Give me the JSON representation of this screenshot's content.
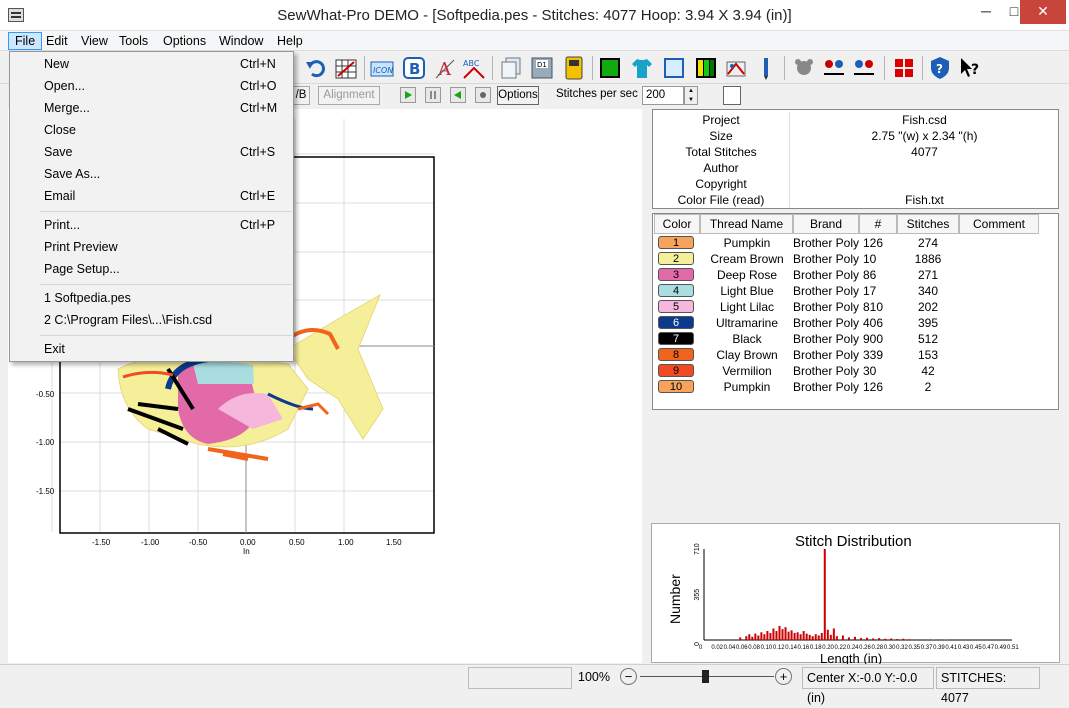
{
  "window": {
    "title": "SewWhat-Pro DEMO - [Softpedia.pes - Stitches: 4077  Hoop: 3.94 X 3.94 (in)]",
    "minimize": "─",
    "maximize": "□",
    "close": "✕"
  },
  "menubar": [
    "File",
    "Edit",
    "View",
    "Tools",
    "Options",
    "Window",
    "Help"
  ],
  "file_menu": {
    "groups": [
      [
        {
          "label": "New",
          "shortcut": "Ctrl+N"
        },
        {
          "label": "Open...",
          "shortcut": "Ctrl+O"
        },
        {
          "label": "Merge...",
          "shortcut": "Ctrl+M"
        },
        {
          "label": "Close",
          "shortcut": ""
        },
        {
          "label": "Save",
          "shortcut": "Ctrl+S"
        },
        {
          "label": "Save As...",
          "shortcut": ""
        },
        {
          "label": "Email",
          "shortcut": "Ctrl+E"
        }
      ],
      [
        {
          "label": "Print...",
          "shortcut": "Ctrl+P"
        },
        {
          "label": "Print Preview",
          "shortcut": ""
        },
        {
          "label": "Page Setup...",
          "shortcut": ""
        }
      ],
      [
        {
          "label": "1 Softpedia.pes",
          "shortcut": ""
        },
        {
          "label": "2 C:\\Program Files\\...\\Fish.csd",
          "shortcut": ""
        }
      ],
      [
        {
          "label": "Exit",
          "shortcut": ""
        }
      ]
    ]
  },
  "toolbar2": {
    "wb_label": "/B",
    "alignment_label": "Alignment",
    "options_label": "Options",
    "spins_label": "Stitches per sec",
    "spins_value": "200"
  },
  "plot": {
    "x_ticks": [
      "-1.50",
      "-1.00",
      "-0.50",
      "0.00",
      "0.50",
      "1.00",
      "1.50"
    ],
    "y_ticks": [
      "-0.50",
      "-1.00",
      "-1.50"
    ],
    "x_unit": "In"
  },
  "info": [
    {
      "key": "Project",
      "value": "Fish.csd"
    },
    {
      "key": "Size",
      "value": "2.75 \"(w) x 2.34 \"(h)"
    },
    {
      "key": "Total Stitches",
      "value": "4077"
    },
    {
      "key": "Author",
      "value": ""
    },
    {
      "key": "Copyright",
      "value": ""
    },
    {
      "key": "Color File (read)",
      "value": "Fish.txt"
    }
  ],
  "thread_headers": [
    "Color",
    "Thread Name",
    "Brand",
    "#",
    "Stitches",
    "Comment"
  ],
  "threads": [
    {
      "n": "1",
      "name": "Pumpkin",
      "brand": "Brother Poly",
      "code": "126",
      "stitches": "274",
      "color": "#f7a35c"
    },
    {
      "n": "2",
      "name": "Cream Brown",
      "brand": "Brother Poly",
      "code": "10",
      "stitches": "1886",
      "color": "#f6ef9a"
    },
    {
      "n": "3",
      "name": "Deep Rose",
      "brand": "Brother Poly",
      "code": "86",
      "stitches": "271",
      "color": "#e26aa8"
    },
    {
      "n": "4",
      "name": "Light Blue",
      "brand": "Brother Poly",
      "code": "17",
      "stitches": "340",
      "color": "#a9dde0"
    },
    {
      "n": "5",
      "name": "Light Lilac",
      "brand": "Brother Poly",
      "code": "810",
      "stitches": "202",
      "color": "#f6b7dc"
    },
    {
      "n": "6",
      "name": "Ultramarine",
      "brand": "Brother Poly",
      "code": "406",
      "stitches": "395",
      "color": "#0c3a8c"
    },
    {
      "n": "7",
      "name": "Black",
      "brand": "Brother Poly",
      "code": "900",
      "stitches": "512",
      "color": "#000000"
    },
    {
      "n": "8",
      "name": "Clay Brown",
      "brand": "Brother Poly",
      "code": "339",
      "stitches": "153",
      "color": "#f0641c"
    },
    {
      "n": "9",
      "name": "Vermilion",
      "brand": "Brother Poly",
      "code": "30",
      "stitches": "42",
      "color": "#f04b22"
    },
    {
      "n": "10",
      "name": "Pumpkin",
      "brand": "Brother Poly",
      "code": "126",
      "stitches": "2",
      "color": "#f7a35c"
    }
  ],
  "chart_data": {
    "type": "bar",
    "title": "Stitch Distribution",
    "xlabel": "Length (in)",
    "ylabel": "Number",
    "xlim": [
      0,
      0.51
    ],
    "ylim": [
      0,
      710
    ],
    "x_ticks": [
      "0",
      "0.02",
      "0.04",
      "0.06",
      "0.08",
      "0.10",
      "0.12",
      "0.14",
      "0.16",
      "0.18",
      "0.20",
      "0.22",
      "0.24",
      "0.26",
      "0.28",
      "0.30",
      "0.32",
      "0.35",
      "0.37",
      "0.39",
      "0.41",
      "0.43",
      "0.45",
      "0.47",
      "0.49",
      "0.51"
    ],
    "y_ticks": [
      "0",
      "355",
      "710"
    ],
    "bar_color": "#cc0000",
    "x": [
      0.06,
      0.07,
      0.075,
      0.08,
      0.085,
      0.09,
      0.095,
      0.1,
      0.105,
      0.11,
      0.115,
      0.12,
      0.125,
      0.13,
      0.135,
      0.14,
      0.145,
      0.15,
      0.155,
      0.16,
      0.165,
      0.17,
      0.175,
      0.18,
      0.185,
      0.19,
      0.195,
      0.2,
      0.205,
      0.21,
      0.215,
      0.22,
      0.23,
      0.24,
      0.25,
      0.26,
      0.27,
      0.28,
      0.29,
      0.3,
      0.31,
      0.32,
      0.33,
      0.34,
      0.36,
      0.38,
      0.4
    ],
    "values": [
      20,
      30,
      45,
      25,
      50,
      35,
      60,
      45,
      70,
      55,
      90,
      70,
      110,
      85,
      100,
      65,
      75,
      55,
      60,
      45,
      70,
      50,
      40,
      30,
      45,
      35,
      55,
      710,
      80,
      40,
      90,
      30,
      35,
      20,
      25,
      15,
      18,
      12,
      15,
      10,
      12,
      8,
      10,
      6,
      5,
      4,
      3
    ]
  },
  "statusbar": {
    "zoom": "100%",
    "center": "Center X:-0.0  Y:-0.0 (in)",
    "stitches": "STITCHES:  4077",
    "zoom_out": "−",
    "zoom_in": "+"
  }
}
